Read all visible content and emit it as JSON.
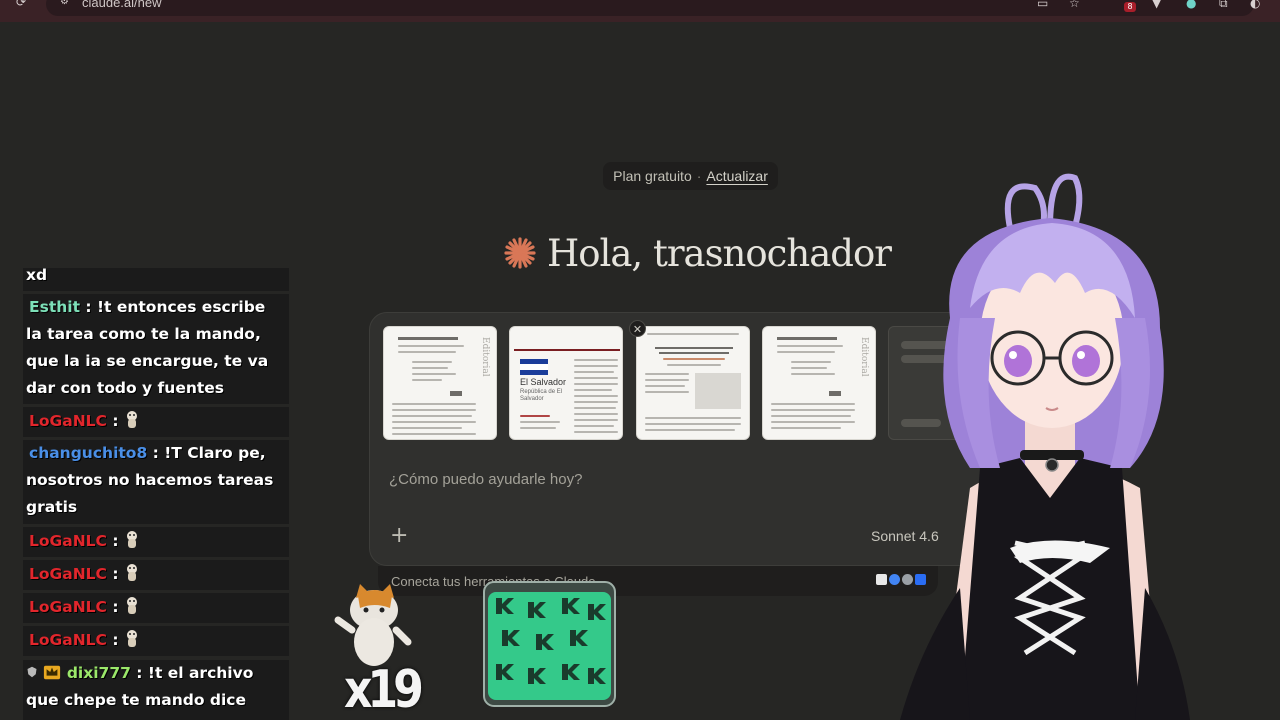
{
  "browser": {
    "url": "claude.ai/new",
    "notification_count": "8"
  },
  "plan": {
    "label": "Plan gratuito",
    "separator": "·",
    "upgrade": "Actualizar"
  },
  "greeting": "Hola, trasnochador",
  "composer": {
    "placeholder": "¿Cómo puedo ayudarle hoy?",
    "model": "Sonnet 4.6",
    "attachments": [
      {
        "name": "editorial-document-1",
        "side_text": "Editorial"
      },
      {
        "name": "el-salvador-document",
        "title": "El Salvador",
        "subtitle": "República de El Salvador"
      },
      {
        "name": "research-article"
      },
      {
        "name": "editorial-document-2",
        "side_text": "Editorial"
      },
      {
        "name": "placeholder-attachment"
      }
    ],
    "close_label": "✕",
    "add_label": "+"
  },
  "connect": {
    "text": "Conecta tus herramientas a Claude"
  },
  "chat": {
    "messages": [
      {
        "user": "",
        "text": "xd"
      },
      {
        "user": "Esthit",
        "text": " : !t entonces escribe la tarea como te la mando, que la ia se encargue, te va dar con todo y fuentes"
      },
      {
        "user": "LoGaNLC",
        "text": " : "
      },
      {
        "user": "changuchito8",
        "text": " : !T Claro pe, nosotros no hacemos tareas gratis"
      },
      {
        "user": "LoGaNLC",
        "text": " : "
      },
      {
        "user": "LoGaNLC",
        "text": " : "
      },
      {
        "user": "LoGaNLC",
        "text": " : "
      },
      {
        "user": "LoGaNLC",
        "text": " : "
      },
      {
        "user": "dixi777",
        "text": " : !t el archivo que chepe te mando dice"
      }
    ]
  },
  "overlay": {
    "combo": "x19"
  },
  "colors": {
    "background": "#262624",
    "composer": "#30302e",
    "accent": "#d97757",
    "browser_bar": "#3a2226"
  }
}
